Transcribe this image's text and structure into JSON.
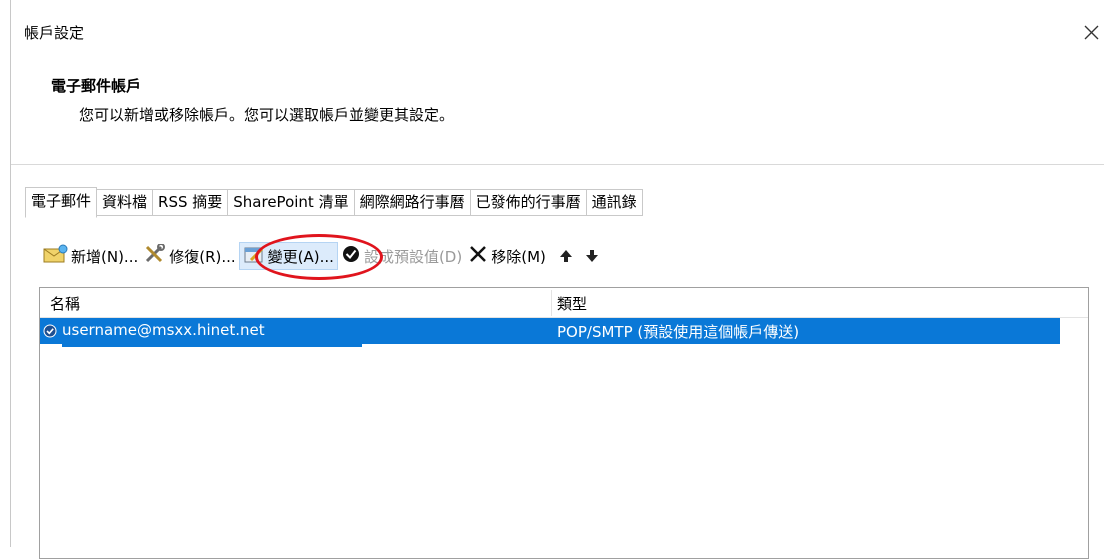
{
  "window": {
    "title": "帳戶設定"
  },
  "header": {
    "title": "電子郵件帳戶",
    "description": "您可以新增或移除帳戶。您可以選取帳戶並變更其設定。"
  },
  "tabs": [
    {
      "label": "電子郵件",
      "active": true
    },
    {
      "label": "資料檔"
    },
    {
      "label": "RSS 摘要"
    },
    {
      "label": "SharePoint 清單"
    },
    {
      "label": "網際網路行事曆"
    },
    {
      "label": "已發佈的行事曆"
    },
    {
      "label": "通訊錄"
    }
  ],
  "toolbar": {
    "add_label": "新增(N)...",
    "repair_label": "修復(R)...",
    "change_label": "變更(A)...",
    "set_default_label": "設成預設值(D)",
    "remove_label": "移除(M)"
  },
  "list": {
    "columns": {
      "name": "名稱",
      "type": "類型"
    },
    "rows": [
      {
        "name": "username@msxx.hinet.net",
        "type": "POP/SMTP (預設使用這個帳戶傳送)",
        "selected": true
      }
    ]
  },
  "colors": {
    "selection": "#0a78d7",
    "annotation": "#e0141d"
  }
}
